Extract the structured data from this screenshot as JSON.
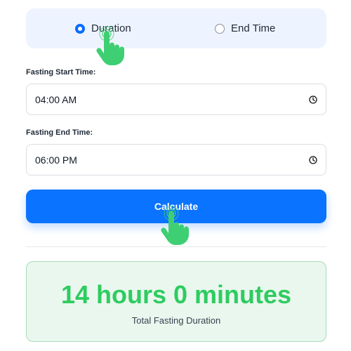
{
  "mode": {
    "options": [
      {
        "label": "Duration",
        "selected": true
      },
      {
        "label": "End Time",
        "selected": false
      }
    ]
  },
  "form": {
    "start_label": "Fasting Start Time:",
    "start_value": "04:00 AM",
    "end_label": "Fasting End Time:",
    "end_value": "06:00 PM",
    "calculate_label": "Calculate"
  },
  "result": {
    "value": "14 hours 0 minutes",
    "label": "Total Fasting Duration"
  },
  "icons": {
    "clock": "clock-icon",
    "pointer": "pointer-hand-icon"
  },
  "colors": {
    "accent": "#0a73ff",
    "result_text": "#2ecc60",
    "result_bg": "#eaf7ee",
    "hand": "#3ecf73"
  }
}
